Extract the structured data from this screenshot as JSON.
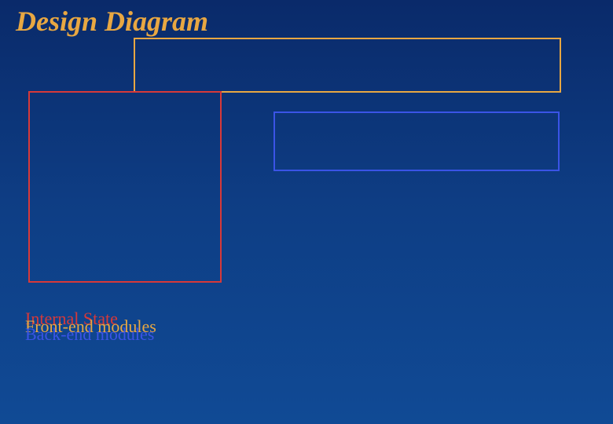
{
  "title": "Design Diagram",
  "boxes": {
    "orange": {
      "label": ""
    },
    "red": {
      "label": ""
    },
    "blue": {
      "label": ""
    }
  },
  "legend": {
    "internal_state": "Internal State",
    "front_end": "Front-end modules",
    "back_end": "Back-end modules"
  },
  "colors": {
    "title": "#e8a742",
    "orange_box": "#e8a742",
    "red_box": "#d73939",
    "blue_box": "#3a54e6"
  }
}
